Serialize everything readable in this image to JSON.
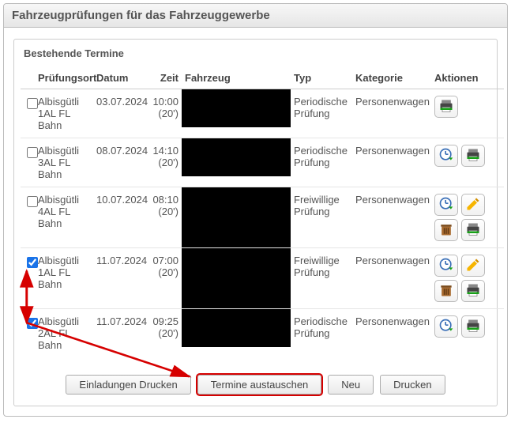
{
  "header": {
    "title": "Fahrzeugprüfungen für das Fahrzeuggewerbe"
  },
  "section": {
    "title": "Bestehende Termine"
  },
  "columns": {
    "ort": "Prüfungsort",
    "datum": "Datum",
    "zeit": "Zeit",
    "fahrzeug": "Fahrzeug",
    "typ": "Typ",
    "kategorie": "Kategorie",
    "aktionen": "Aktionen"
  },
  "rows": [
    {
      "checked": false,
      "ort": "Albisgütli 1AL FL Bahn",
      "datum": "03.07.2024",
      "zeit": "10:00",
      "dauer": "(20')",
      "typ": "Periodische Prüfung",
      "kategorie": "Personenwagen",
      "actions": [
        "print"
      ]
    },
    {
      "checked": false,
      "ort": "Albisgütli 3AL FL Bahn",
      "datum": "08.07.2024",
      "zeit": "14:10",
      "dauer": "(20')",
      "typ": "Periodische Prüfung",
      "kategorie": "Personenwagen",
      "actions": [
        "reschedule",
        "print"
      ]
    },
    {
      "checked": false,
      "ort": "Albisgütli 4AL FL Bahn",
      "datum": "10.07.2024",
      "zeit": "08:10",
      "dauer": "(20')",
      "typ": "Freiwillige Prüfung",
      "kategorie": "Personenwagen",
      "actions": [
        "reschedule",
        "edit",
        "delete",
        "print"
      ]
    },
    {
      "checked": true,
      "ort": "Albisgütli 1AL FL Bahn",
      "datum": "11.07.2024",
      "zeit": "07:00",
      "dauer": "(20')",
      "typ": "Freiwillige Prüfung",
      "kategorie": "Personenwagen",
      "actions": [
        "reschedule",
        "edit",
        "delete",
        "print"
      ]
    },
    {
      "checked": true,
      "ort": "Albisgütli 2AL FL Bahn",
      "datum": "11.07.2024",
      "zeit": "09:25",
      "dauer": "(20')",
      "typ": "Periodische Prüfung",
      "kategorie": "Personenwagen",
      "actions": [
        "reschedule",
        "print"
      ]
    }
  ],
  "buttons": {
    "einladungen": "Einladungen Drucken",
    "austauschen": "Termine austauschen",
    "neu": "Neu",
    "drucken": "Drucken"
  },
  "icons": {
    "print": "print-icon",
    "reschedule": "clock-reschedule-icon",
    "edit": "pencil-icon",
    "delete": "trash-icon"
  }
}
